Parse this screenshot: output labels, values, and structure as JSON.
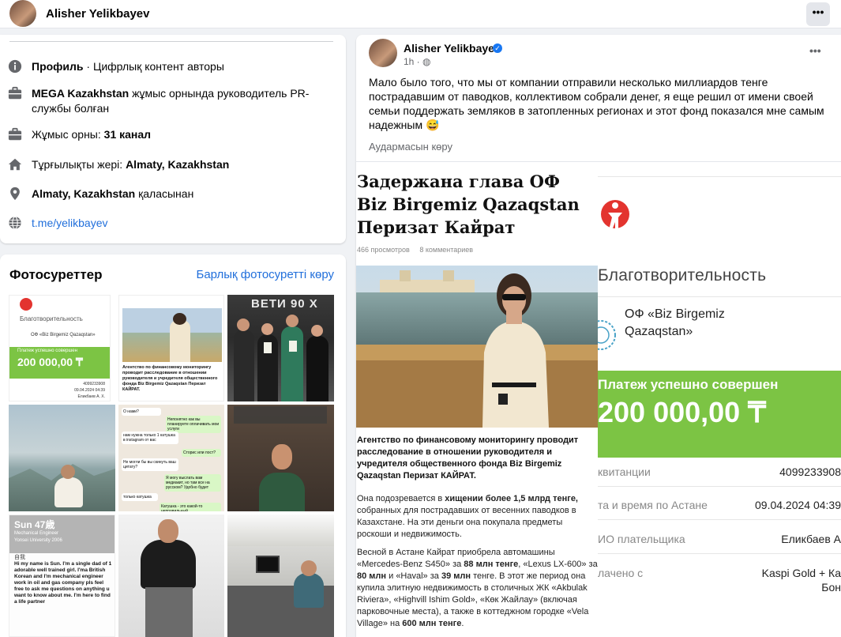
{
  "header": {
    "profile_name": "Alisher Yelikbayev",
    "more_label": "•••"
  },
  "intro": {
    "items": [
      {
        "icon": "info-icon",
        "bold": "Профиль",
        "text": " · Цифрлық контент авторы"
      },
      {
        "icon": "briefcase-icon",
        "bold": "MEGA Kazakhstan",
        "text": " жұмыс орнында руководитель PR-службы болған"
      },
      {
        "icon": "briefcase-icon",
        "prefix": "Жұмыс орны: ",
        "bold": "31 канал",
        "text": ""
      },
      {
        "icon": "home-icon",
        "prefix": "Тұрғылықты жері: ",
        "bold": "Almaty, Kazakhstan",
        "text": ""
      },
      {
        "icon": "location-pin-icon",
        "bold": "Almaty, Kazakhstan",
        "text": " қаласынан"
      },
      {
        "icon": "globe-icon",
        "link": "t.me/yelikbayev"
      }
    ]
  },
  "photos": {
    "title": "Фотосуреттер",
    "see_all": "Барлық фотосуретті көру",
    "thumbs": [
      {
        "label": "Благотворительность / ОФ «Biz Birgemiz Qazaqstan» / Платеж успешно совершен / 200 000,00 ₸"
      },
      {
        "label": "Агентство по финансовому мониторингу проводит расследование в отношении руководителя и учредителя общественного фонда Biz Birgemiz Qazaqstan Перизат КАЙРАТ."
      },
      {
        "label": "ВЕТИ 90 Х"
      },
      {
        "label": "mountain portrait"
      },
      {
        "label": "chat screenshot"
      },
      {
        "label": "portrait in green sweater"
      },
      {
        "label": "Sun 47歳 — Hi my name is Sun. I'm a single dad of 1 adorable well trained girl. I'ma British Korean and I'm mechanical engineer work in oil and gas company pls feel free to ask me questions on anything u want to know about me. I'm here to find a life partner"
      },
      {
        "label": "man in black t-shirt"
      },
      {
        "label": "business class seat"
      }
    ],
    "chat": {
      "l1": "О нами?",
      "r1": "Непонятно как вы планируете оплачивать мои услуги",
      "l2": "нам нужна только 1 катушка в instagram от вас",
      "r2": "Сторис или пост?",
      "l3": "Не могли бы вы скинуть ваш цитату?",
      "r3": "Я могу выслать вам медиакит, но там все на русском? Удобно будет",
      "l4": "только катушка",
      "l5": "Катушка - это какой-то неправильный"
    },
    "sun": {
      "title": "Sun 47歳",
      "sub1": "Mechanical Engineer",
      "sub2": "Yonsei University 2006",
      "label": "自我",
      "body": "Hi my name is Sun. I'm a single dad of 1 adorable well trained girl. I'ma British Korean and I'm mechanical engineer work in oil and gas company pls feel free to ask me questions on anything u want to know about me. I'm here to find a life partner"
    },
    "mini_receipt": {
      "charity": "Благотворительность",
      "fund": "ОФ «Biz Birgemiz Qazaqstan»",
      "status": "Платеж успешно совершен",
      "sum": "200 000,00 ₸",
      "row1v": "4099233908",
      "row2v": "09.04.2024 04:39",
      "row3v": "Еликбаев А. Х."
    },
    "mini_article_text": "Агентство по финансовому мониторингу проводит расследование в отношении руководителя и учредителя общественного фонда Biz Birgemiz Qazaqstan Перизат КАЙРАТ.",
    "retro_title": "ВЕТИ 90 Х"
  },
  "post": {
    "author": "Alisher Yelikbayev",
    "time": "1h · ",
    "text": "Мало было того, что мы от компании отправили несколько миллиардов тенге пострадавшим от паводков, коллективом собрали денег, я еще решил от имени своей семьи поддержать земляков в затопленных регионах и этот фонд показался мне самым надежным 😅",
    "translate": "Аудармасын көру",
    "article": {
      "headline": "Задержана глава ОФ Biz Birgemiz Qazaqstan Перизат Кайрат",
      "views": "466 просмотров",
      "comments": "8 комментариев",
      "lead": "Агентство по финансовому мониторингу проводит расследование в отношении руководителя и учредителя общественного фонда Biz Birgemiz Qazaqstan Перизат КАЙРАТ.",
      "p1a": "Она подозревается в ",
      "p1b": "хищении более 1,5 млрд тенге,",
      "p1c": " собранных для пострадавших от весенних паводков в Казахстане. На эти деньги она покупала предметы роскоши и недвижимость.",
      "p2a": "Весной в Астане Кайрат приобрела автомашины «Mercedes-Benz S450» за ",
      "p2b": "88 млн тенге",
      "p2c": ", «Lexus LX-600» за ",
      "p2d": "80 млн",
      "p2e": " и «Haval» за ",
      "p2f": "39 млн",
      "p2g": " тенге. В этот же период она купила элитную недвижимость в столичных ЖК «Akbulak Riviera», «Highvill Ishim Gold», «Көк Жайлау» (включая парковочные места), а также в коттеджном городке «Vela Village» на ",
      "p2h": "600 млн тенге",
      "p2i": "."
    },
    "receipt": {
      "charity": "Благотворительность",
      "fund": "ОФ «Biz Birgemiz Qazaqstan»",
      "status": "Платеж успешно совершен",
      "sum": "200 000,00 ₸",
      "rows": [
        {
          "k": "квитанции",
          "v": "4099233908"
        },
        {
          "k": "та и время по Астане",
          "v": "09.04.2024 04:39"
        },
        {
          "k": "ИО плательщика",
          "v": "Еликбаев А"
        },
        {
          "k": "лачено с",
          "v": "Kaspi Gold + Ка"
        },
        {
          "k": "",
          "v": "Бон"
        }
      ]
    }
  },
  "colors": {
    "link": "#216fdb",
    "accent_green": "#7cc444",
    "verified": "#1877f2"
  }
}
